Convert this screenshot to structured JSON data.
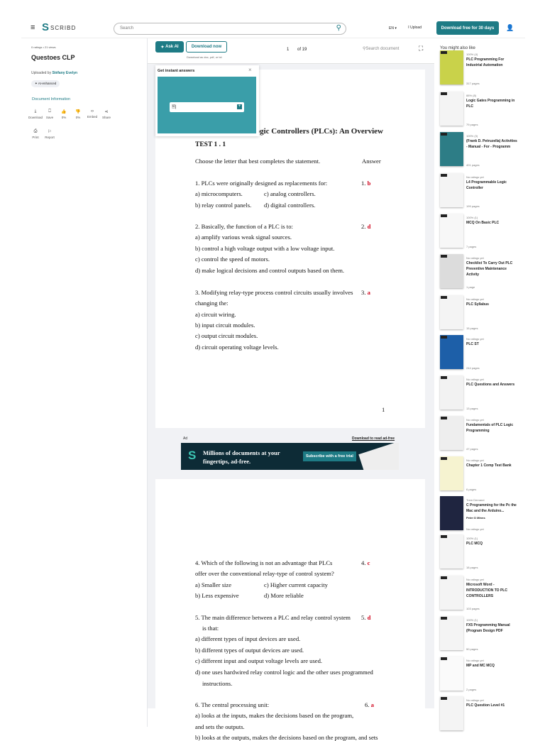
{
  "nav": {
    "brand": "SCRIBD",
    "search_placeholder": "Search",
    "lang": "EN",
    "upload": "Upload",
    "cta": "Download free for 30 days"
  },
  "doc_info": {
    "stats": "0 ratings • 21 views",
    "title": "Questoes CLP",
    "uploaded_by_label": "Uploaded by",
    "uploader": "Stéfany Evelyn",
    "ai_badge": "AI-enhanced",
    "info_link": "Document Information",
    "actions": [
      "Download",
      "Save",
      "0%",
      "0%",
      "Embed",
      "Share",
      "Print",
      "Report"
    ]
  },
  "toolbar": {
    "ask_ai": "Ask AI",
    "download_now": "Download now",
    "download_sub": "Download as doc, pdf, or txt",
    "page_current": "1",
    "page_total": "of 19",
    "search_doc_placeholder": "Search document"
  },
  "ai_popup": {
    "title": "Get instant answers",
    "input_value": ""
  },
  "page1": {
    "title": "Programmable Logic Controllers (PLCs): An Overview",
    "page_number": "1",
    "lines": [
      {
        "t": "TEST  1 . 1",
        "bold": true
      },
      {
        "t": "Choose the letter that best completes the statement.",
        "ans_label": "Answer"
      },
      {
        "t": "1. PLCs were originally designed as replacements for:",
        "num": "1.",
        "ans": "b"
      },
      {
        "t": "a) microcomputers.",
        "t2": "c) analog controllers."
      },
      {
        "t": "b) relay control panels.",
        "t2": "d) digital controllers."
      },
      {
        "t": "2. Basically, the function of a PLC is to:",
        "num": "2.",
        "ans": "d"
      },
      {
        "t": "a) amplify various weak signal sources."
      },
      {
        "t": "b) control a high voltage output with a low voltage input."
      },
      {
        "t": "c) control the speed of motors."
      },
      {
        "t": "d) make logical decisions and control outputs based on them."
      },
      {
        "t": "3. Modifying relay-type process control circuits usually involves",
        "num": "3.",
        "ans": "a"
      },
      {
        "t": "changing the:"
      },
      {
        "t": "a) circuit wiring."
      },
      {
        "t": "b) input circuit modules."
      },
      {
        "t": "c) output circuit modules."
      },
      {
        "t": "d) circuit operating voltage levels."
      }
    ]
  },
  "ad": {
    "label": "Ad",
    "download_link": "Download to read ad-free",
    "headline": "Millions of documents at your fingertips, ad-free.",
    "button": "Subscribe with a free trial"
  },
  "page2": {
    "lines": [
      {
        "t": "4. Which of the following is not an advantage that PLCs",
        "num": "4.",
        "ans": "c"
      },
      {
        "t": "offer over the conventional relay-type of control system?"
      },
      {
        "t": "a) Smaller size",
        "t2": "c) Higher current capacity"
      },
      {
        "t": "b) Less expensive",
        "t2": "d) More reliable"
      },
      {
        "t": "5. The main difference between a PLC and relay control system",
        "num": "5.",
        "ans": "d"
      },
      {
        "t": "is that:"
      },
      {
        "t": "a) different types of input devices are used."
      },
      {
        "t": "b) different types of output devices are used."
      },
      {
        "t": "c) different input and output voltage levels are used."
      },
      {
        "t": "d) one uses hardwired relay control logic and the other uses programmed"
      },
      {
        "t": "instructions."
      },
      {
        "t": "6. The central processing unit:",
        "num": "6.",
        "ans": "a"
      },
      {
        "t": "a) looks at the inputs, makes the decisions based on the program,"
      },
      {
        "t": "and sets the outputs."
      },
      {
        "t": "b) looks at the outputs, makes the decisions based on the program, and sets"
      }
    ]
  },
  "recs": {
    "heading": "You might also like",
    "items": [
      {
        "meta": "100% (4)",
        "title": "PLC Programming For Industrial Automation",
        "pages": "317 pages",
        "color": "#c9d24a"
      },
      {
        "meta": "88% (8)",
        "title": "Logic Gates Programming in PLC",
        "pages": "79 pages",
        "color": "#f4f4f4"
      },
      {
        "meta": "100% (3)",
        "title": "(Frank D. Petruzella) Activities - Manual - For - Programm",
        "pages": "401 pages",
        "color": "#2d7d86"
      },
      {
        "meta": "No ratings yet",
        "title": "L4 Programmable Logic Controller",
        "pages": "199 pages",
        "color": "#f4f4f4"
      },
      {
        "meta": "100% (1)",
        "title": "MCQ On Basic PLC",
        "pages": "7 pages",
        "color": "#f7f7f7"
      },
      {
        "meta": "No ratings yet",
        "title": "Checklist To Carry Out PLC Preventive Maintenance Activity",
        "pages": "1 page",
        "color": "#dcdcdc"
      },
      {
        "meta": "No ratings yet",
        "title": "PLC Syllabus",
        "pages": "15 pages",
        "color": "#f4f4f4"
      },
      {
        "meta": "No ratings yet",
        "title": "PLC ST",
        "pages": "244 pages",
        "color": "#1d5fa8"
      },
      {
        "meta": "No ratings yet",
        "title": "PLC Questions and Answers",
        "pages": "13 pages",
        "color": "#f2f2f2"
      },
      {
        "meta": "No ratings yet",
        "title": "Fundamentals of PLC Logic Programming",
        "pages": "47 pages",
        "color": "#eeeeee"
      },
      {
        "meta": "No ratings yet",
        "title": "Chapter 1 Comp Test Bank",
        "pages": "6 pages",
        "color": "#f6f3d0"
      },
      {
        "meta": "Trem Demand",
        "title": "C Programming for the Pc the Mac and the Arduino...",
        "author": "Peter D Minns",
        "pages": "No ratings yet",
        "color": "#1f2540"
      },
      {
        "meta": "100% (1)",
        "title": "PLC MCQ",
        "pages": "18 pages",
        "color": "#f4f4f4"
      },
      {
        "meta": "No ratings yet",
        "title": "Microsoft Word - INTRODUCTION TO PLC CONTROLLERS",
        "pages": "103 pages",
        "color": "#f4f4f4"
      },
      {
        "meta": "100% (1)",
        "title": "FX5 Programming Manual (Program Design PDF",
        "pages": "50 pages",
        "color": "#f4f4f4"
      },
      {
        "meta": "No ratings yet",
        "title": "MP and MC MCQ",
        "pages": "2 pages",
        "color": "#fafafa"
      },
      {
        "meta": "No ratings yet",
        "title": "PLC Question Level #1",
        "pages": "",
        "color": "#f4f4f4"
      }
    ]
  },
  "colors": {
    "brand": "#1e7b85",
    "answer": "#d0021b",
    "ad_bg": "#0d2b36"
  }
}
